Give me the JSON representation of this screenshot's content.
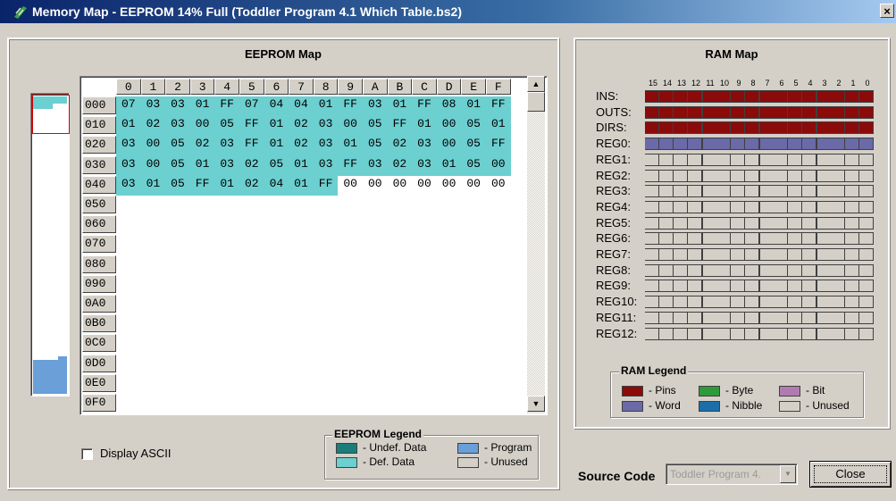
{
  "window": {
    "title": "Memory Map - EEPROM 14% Full (Toddler Program 4.1 Which Table.bs2)",
    "close_glyph": "×"
  },
  "eeprom": {
    "title": "EEPROM Map",
    "columns": [
      "0",
      "1",
      "2",
      "3",
      "4",
      "5",
      "6",
      "7",
      "8",
      "9",
      "A",
      "B",
      "C",
      "D",
      "E",
      "F"
    ],
    "rows": [
      {
        "addr": "000",
        "bytes": [
          "07",
          "03",
          "03",
          "01",
          "FF",
          "07",
          "04",
          "04",
          "01",
          "FF",
          "03",
          "01",
          "FF",
          "08",
          "01",
          "FF"
        ]
      },
      {
        "addr": "010",
        "bytes": [
          "01",
          "02",
          "03",
          "00",
          "05",
          "FF",
          "01",
          "02",
          "03",
          "00",
          "05",
          "FF",
          "01",
          "00",
          "05",
          "01"
        ]
      },
      {
        "addr": "020",
        "bytes": [
          "03",
          "00",
          "05",
          "02",
          "03",
          "FF",
          "01",
          "02",
          "03",
          "01",
          "05",
          "02",
          "03",
          "00",
          "05",
          "FF"
        ]
      },
      {
        "addr": "030",
        "bytes": [
          "03",
          "00",
          "05",
          "01",
          "03",
          "02",
          "05",
          "01",
          "03",
          "FF",
          "03",
          "02",
          "03",
          "01",
          "05",
          "00"
        ]
      },
      {
        "addr": "040",
        "bytes": [
          "03",
          "01",
          "05",
          "FF",
          "01",
          "02",
          "04",
          "01",
          "FF",
          "00",
          "00",
          "00",
          "00",
          "00",
          "00",
          "00"
        ]
      },
      {
        "addr": "050",
        "bytes": []
      },
      {
        "addr": "060",
        "bytes": []
      },
      {
        "addr": "070",
        "bytes": []
      },
      {
        "addr": "080",
        "bytes": []
      },
      {
        "addr": "090",
        "bytes": []
      },
      {
        "addr": "0A0",
        "bytes": []
      },
      {
        "addr": "0B0",
        "bytes": []
      },
      {
        "addr": "0C0",
        "bytes": []
      },
      {
        "addr": "0D0",
        "bytes": []
      },
      {
        "addr": "0E0",
        "bytes": []
      },
      {
        "addr": "0F0",
        "bytes": []
      }
    ],
    "defined_count": 73,
    "display_ascii_label": "Display ASCII",
    "display_ascii_checked": false,
    "legend": {
      "title": "EEPROM Legend",
      "items": [
        {
          "label": "- Undef. Data",
          "color": "#1a7d7a"
        },
        {
          "label": "- Def. Data",
          "color": "#6ccfd0"
        },
        {
          "label": "- Program",
          "color": "#6a9fd8"
        },
        {
          "label": "- Unused",
          "color": "#d4d0c8"
        }
      ]
    }
  },
  "ram": {
    "title": "RAM Map",
    "bit_numbers": [
      "15",
      "14",
      "13",
      "12",
      "11",
      "10",
      "9",
      "8",
      "7",
      "6",
      "5",
      "4",
      "3",
      "2",
      "1",
      "0"
    ],
    "registers": [
      {
        "name": "INS:",
        "type": "pins"
      },
      {
        "name": "OUTS:",
        "type": "pins"
      },
      {
        "name": "DIRS:",
        "type": "pins"
      },
      {
        "name": "REG0:",
        "type": "word"
      },
      {
        "name": "REG1:",
        "type": "unused"
      },
      {
        "name": "REG2:",
        "type": "unused"
      },
      {
        "name": "REG3:",
        "type": "unused"
      },
      {
        "name": "REG4:",
        "type": "unused"
      },
      {
        "name": "REG5:",
        "type": "unused"
      },
      {
        "name": "REG6:",
        "type": "unused"
      },
      {
        "name": "REG7:",
        "type": "unused"
      },
      {
        "name": "REG8:",
        "type": "unused"
      },
      {
        "name": "REG9:",
        "type": "unused"
      },
      {
        "name": "REG10:",
        "type": "unused"
      },
      {
        "name": "REG11:",
        "type": "unused"
      },
      {
        "name": "REG12:",
        "type": "unused"
      }
    ],
    "colors": {
      "pins": "#8b0a0a",
      "word": "#6a6aa8",
      "byte": "#2e9a3a",
      "nibble": "#1a6fa8",
      "bit": "#b07cb0",
      "unused": "#d4d0c8"
    },
    "legend": {
      "title": "RAM Legend",
      "items": [
        {
          "label": "- Pins",
          "color": "#8b0a0a"
        },
        {
          "label": "- Byte",
          "color": "#2e9a3a"
        },
        {
          "label": "- Bit",
          "color": "#b07cb0"
        },
        {
          "label": "- Word",
          "color": "#6a6aa8"
        },
        {
          "label": "- Nibble",
          "color": "#1a6fa8"
        },
        {
          "label": "- Unused",
          "color": "#d4d0c8"
        }
      ]
    }
  },
  "footer": {
    "source_code_label": "Source Code",
    "source_code_value": "Toddler Program 4.",
    "close_label": "Close"
  }
}
